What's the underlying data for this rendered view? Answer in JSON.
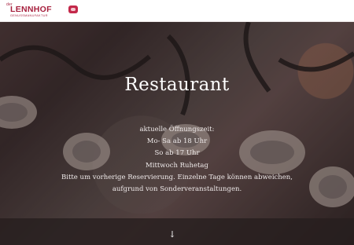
{
  "brand": {
    "prefix": "der",
    "name": "LENNHOF",
    "tagline": "GENUSSMANUFAKTUR"
  },
  "hero": {
    "title": "Restaurant",
    "lines": [
      "aktuelle Öffnungszeit:",
      "Mo- Sa ab 18 Uhr",
      "So ab 17 Uhr",
      "Mittwoch Ruhetag",
      "Bitte um vorherige Reservierung. Einzelne Tage können abweichen,",
      "aufgrund von Sonderveranstaltungen."
    ],
    "scroll_glyph": "↓"
  },
  "colors": {
    "brand": "#a61f3d",
    "overlay": "#3a2d2e"
  },
  "icons": {
    "scroll": "arrow-down-icon",
    "logo_badge": "logo-badge-icon"
  }
}
